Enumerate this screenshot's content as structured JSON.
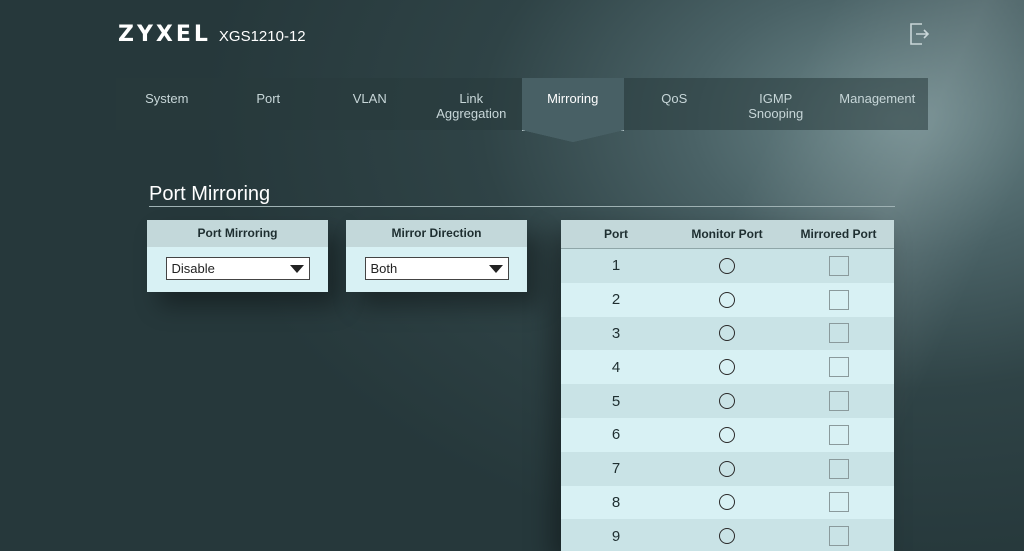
{
  "header": {
    "brand": "ZYXEL",
    "model": "XGS1210-12",
    "logout_icon": "logout-icon"
  },
  "nav": {
    "items": [
      {
        "line1": "System",
        "line2": ""
      },
      {
        "line1": "Port",
        "line2": ""
      },
      {
        "line1": "VLAN",
        "line2": ""
      },
      {
        "line1": "Link",
        "line2": "Aggregation"
      },
      {
        "line1": "Mirroring",
        "line2": ""
      },
      {
        "line1": "QoS",
        "line2": ""
      },
      {
        "line1": "IGMP",
        "line2": "Snooping"
      },
      {
        "line1": "Management",
        "line2": ""
      }
    ],
    "active": "Mirroring"
  },
  "page": {
    "title": "Port Mirroring"
  },
  "mirroring_card": {
    "header": "Port Mirroring",
    "value": "Disable"
  },
  "direction_card": {
    "header": "Mirror Direction",
    "value": "Both"
  },
  "ports_table": {
    "columns": [
      "Port",
      "Monitor Port",
      "Mirrored Port"
    ],
    "rows": [
      {
        "port": "1",
        "monitor": false,
        "mirrored": false
      },
      {
        "port": "2",
        "monitor": false,
        "mirrored": false
      },
      {
        "port": "3",
        "monitor": false,
        "mirrored": false
      },
      {
        "port": "4",
        "monitor": false,
        "mirrored": false
      },
      {
        "port": "5",
        "monitor": false,
        "mirrored": false
      },
      {
        "port": "6",
        "monitor": false,
        "mirrored": false
      },
      {
        "port": "7",
        "monitor": false,
        "mirrored": false
      },
      {
        "port": "8",
        "monitor": false,
        "mirrored": false
      },
      {
        "port": "9",
        "monitor": false,
        "mirrored": false
      }
    ]
  },
  "colors": {
    "background": "#2f4346",
    "panel": "#d8f1f4",
    "panel_header": "#c3d8da",
    "active_tab": "#486065"
  }
}
